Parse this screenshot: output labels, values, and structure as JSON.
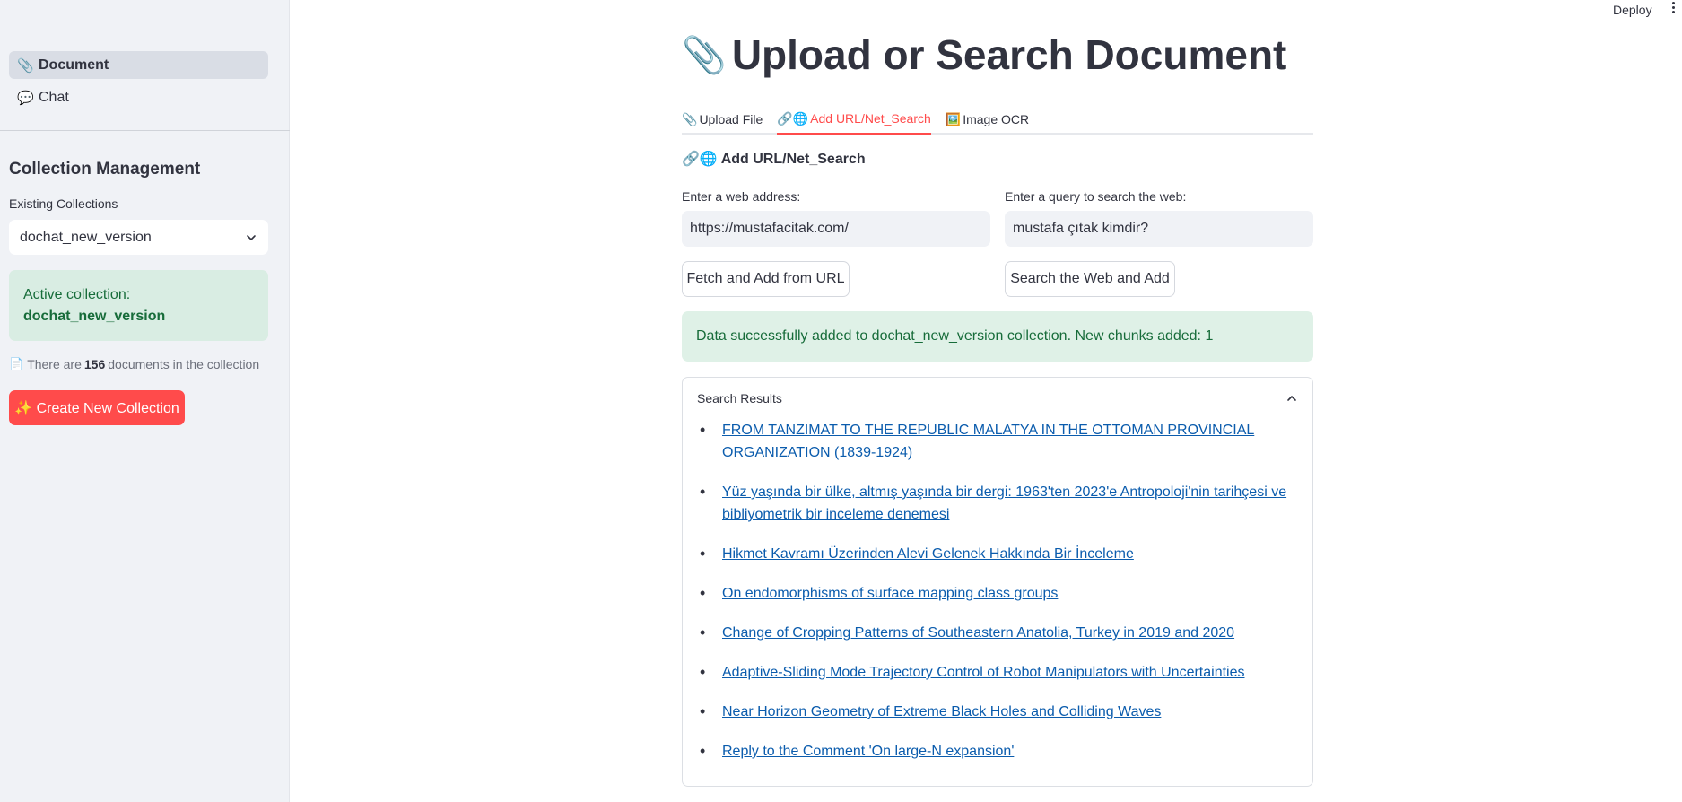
{
  "header": {
    "deploy_label": "Deploy"
  },
  "sidebar": {
    "nav": [
      {
        "icon": "📎",
        "label": "Document",
        "active": true
      },
      {
        "icon": "💬",
        "label": "Chat",
        "active": false
      }
    ],
    "collection_title": "Collection Management",
    "existing_label": "Existing Collections",
    "selected_collection": "dochat_new_version",
    "active_prefix": "Active collection:",
    "active_name": "dochat_new_version",
    "doc_count_prefix": "There are",
    "doc_count": "156",
    "doc_count_suffix": "documents in the collection",
    "create_button": "✨ Create New Collection"
  },
  "main": {
    "title_icon": "📎",
    "title": "Upload or Search Document",
    "tabs": [
      {
        "icon": "📎",
        "label": "Upload File",
        "active": false
      },
      {
        "icon": "🔗🌐",
        "label": "Add URL/Net_Search",
        "active": true
      },
      {
        "icon": "🖼️",
        "label": "Image OCR",
        "active": false
      }
    ],
    "section_title": "🔗🌐 Add URL/Net_Search",
    "url_label": "Enter a web address:",
    "url_value": "https://mustafacitak.com/",
    "query_label": "Enter a query to search the web:",
    "query_value": "mustafa çıtak kimdir?",
    "fetch_button": "Fetch and Add from URL",
    "search_button": "Search the Web and Add",
    "success_message": "Data successfully added to dochat_new_version collection. New chunks added: 1",
    "results_title": "Search Results",
    "results": [
      "FROM TANZIMAT TO THE REPUBLIC MALATYA IN THE OTTOMAN PROVINCIAL ORGANIZATION (1839-1924)",
      "Yüz yaşında bir ülke, altmış yaşında bir dergi: 1963'ten 2023'e Antropoloji'nin tarihçesi ve bibliyometrik bir inceleme denemesi",
      "Hikmet Kavramı Üzerinden Alevi Gelenek Hakkında Bir İnceleme",
      "On endomorphisms of surface mapping class groups",
      "Change of Cropping Patterns of Southeastern Anatolia, Turkey in 2019 and 2020",
      "Adaptive-Sliding Mode Trajectory Control of Robot Manipulators with Uncertainties",
      "Near Horizon Geometry of Extreme Black Holes and Colliding Waves",
      "Reply to the Comment 'On large-N expansion'"
    ]
  },
  "colors": {
    "accent": "#ff4b4b",
    "success_bg": "#dff1e7",
    "success_text": "#176c3a",
    "link": "#0b5cad",
    "sidebar_bg": "#f0f2f6"
  }
}
